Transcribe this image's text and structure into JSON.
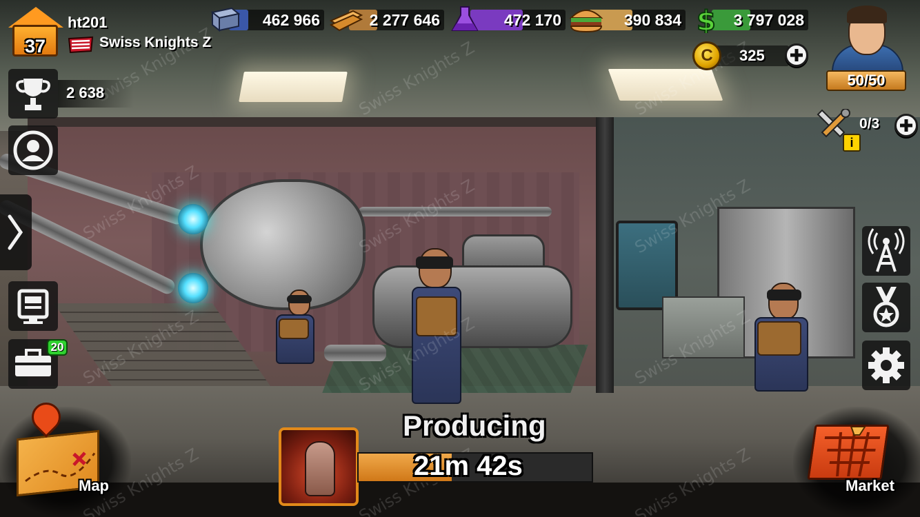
{
  "player": {
    "level": "37",
    "name": "ht201",
    "clan": "Swiss Knights Z"
  },
  "resources": [
    {
      "id": "steel",
      "icon": "steel-beam-icon",
      "value": "462 966",
      "color": "#3a57a8"
    },
    {
      "id": "wood",
      "icon": "wood-planks-icon",
      "value": "2 277 646",
      "color": "#b07a3a"
    },
    {
      "id": "chemicals",
      "icon": "flask-icon",
      "value": "472 170",
      "color": "#7a3ac0"
    },
    {
      "id": "food",
      "icon": "burger-icon",
      "value": "390 834",
      "color": "#c99a50"
    },
    {
      "id": "cash",
      "icon": "dollar-icon",
      "value": "3 797 028",
      "color": "#3a9a3a"
    }
  ],
  "coins": {
    "icon": "gold-coin-icon",
    "symbol": "C",
    "value": "325"
  },
  "energy": "50/50",
  "builders": {
    "icon": "tools-icon",
    "info": "i",
    "value": "0/3"
  },
  "trophies": {
    "icon": "trophy-icon",
    "value": "2 638"
  },
  "left_menu": [
    {
      "name": "profile-button",
      "icon": "profile-icon"
    },
    {
      "name": "expand-menu-button",
      "icon": "chevron-right-icon"
    },
    {
      "name": "news-button",
      "icon": "monitor-icon"
    },
    {
      "name": "inventory-button",
      "icon": "toolbox-icon",
      "badge": "20"
    }
  ],
  "right_menu": [
    {
      "name": "radio-tower-button",
      "icon": "radio-tower-icon"
    },
    {
      "name": "achievements-button",
      "icon": "medal-icon"
    },
    {
      "name": "settings-button",
      "icon": "gear-icon"
    }
  ],
  "production": {
    "status": "Producing",
    "timer": "21m 42s",
    "progress": 0.4,
    "item_icon": "zombie-hand-icon"
  },
  "nav": {
    "map_label": "Map",
    "market_label": "Market"
  },
  "watermark": "Swiss Knights Z"
}
